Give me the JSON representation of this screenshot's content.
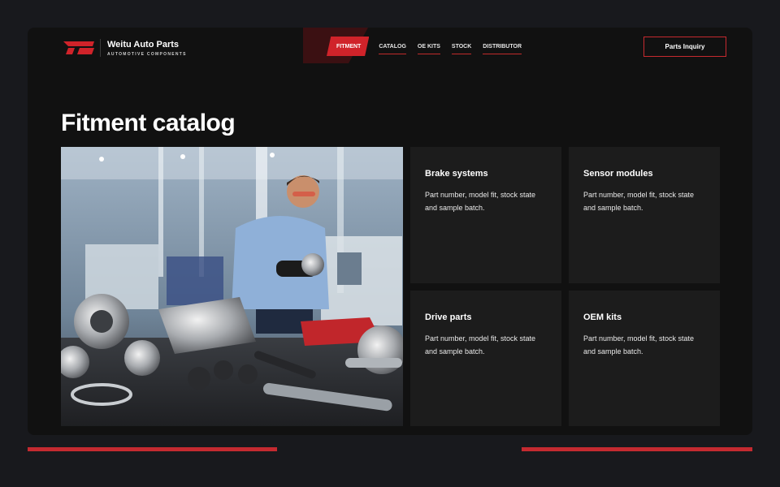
{
  "brand": {
    "name": "Weitu Auto Parts",
    "tagline": "AUTOMOTIVE COMPONENTS",
    "accent": "#d0232a"
  },
  "nav": {
    "items": [
      {
        "label": "FITMENT",
        "active": true
      },
      {
        "label": "CATALOG",
        "active": false
      },
      {
        "label": "OE KITS",
        "active": false
      },
      {
        "label": "STOCK",
        "active": false
      },
      {
        "label": "DISTRIBUTOR",
        "active": false
      }
    ]
  },
  "header": {
    "cta_label": "Parts Inquiry"
  },
  "main": {
    "title": "Fitment catalog",
    "cards": [
      {
        "title": "Brake systems",
        "desc": "Part number, model fit, stock state and sample batch."
      },
      {
        "title": "Sensor modules",
        "desc": "Part number, model fit, stock state and sample batch."
      },
      {
        "title": "Drive parts",
        "desc": "Part number, model fit, stock state and sample batch."
      },
      {
        "title": "OEM kits",
        "desc": "Part number, model fit, stock state and sample batch."
      }
    ]
  }
}
